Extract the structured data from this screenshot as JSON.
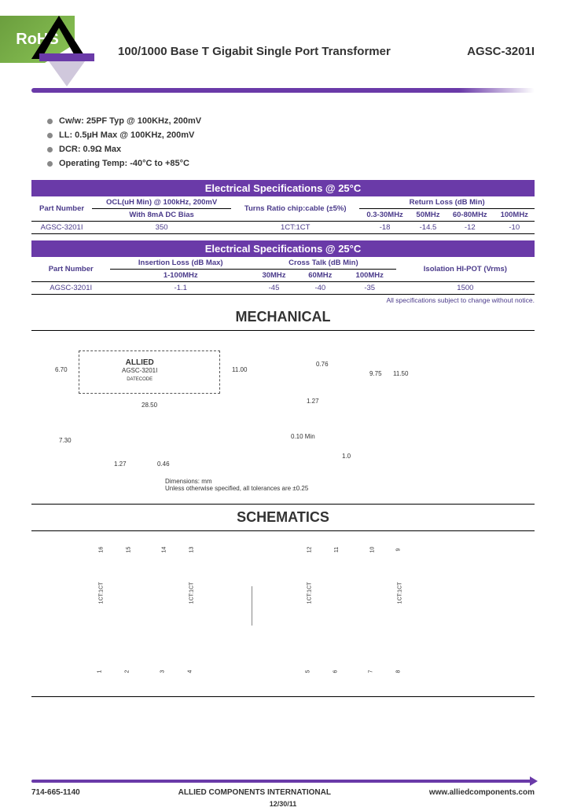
{
  "badge": "RoHS",
  "header": {
    "title": "100/1000 Base T Gigabit Single Port Transformer",
    "part": "AGSC-3201I"
  },
  "bullets": [
    "Cw/w: 25PF Typ @ 100KHz, 200mV",
    "LL: 0.5µH Max @ 100KHz, 200mV",
    "DCR: 0.9Ω Max",
    "Operating Temp: -40°C to +85°C"
  ],
  "tables_header": "Electrical Specifications @ 25°C",
  "table1": {
    "headers": {
      "part": "Part Number",
      "ocl": "OCL(uH Min) @ 100kHz, 200mV",
      "ocl_sub": "With 8mA DC Bias",
      "turns": "Turns Ratio chip:cable (±5%)",
      "rl": "Return Loss (dB Min)",
      "rl_cols": [
        "0.3-30MHz",
        "50MHz",
        "60-80MHz",
        "100MHz"
      ]
    },
    "row": {
      "part": "AGSC-3201I",
      "ocl": "350",
      "turns": "1CT:1CT",
      "rl": [
        "-18",
        "-14.5",
        "-12",
        "-10"
      ]
    }
  },
  "table2": {
    "headers": {
      "part": "Part Number",
      "il": "Insertion Loss (dB Max)",
      "il_sub": "1-100MHz",
      "ct": "Cross Talk (dB Min)",
      "ct_cols": [
        "30MHz",
        "60MHz",
        "100MHz"
      ],
      "iso": "Isolation HI-POT (Vrms)"
    },
    "row": {
      "part": "AGSC-3201I",
      "il": "-1.1",
      "ct": [
        "-45",
        "-40",
        "-35"
      ],
      "iso": "1500"
    },
    "footnote": "All specifications subject to change without notice."
  },
  "mechanical": {
    "title": "MECHANICAL",
    "brand": "ALLIED",
    "part": "AGSC-3201I",
    "dims": {
      "d1": "6.70",
      "d2": "11.00",
      "d3": "0.76",
      "d4": "9.75",
      "d5": "11.50",
      "d6": "28.50",
      "d7": "1.27",
      "d8": "7.30",
      "d9": "1.27",
      "d10": "0.46",
      "d11": "0.10 Min",
      "d12": "1.0"
    },
    "datecode": "DATECODE",
    "note_title": "Dimensions: mm",
    "note": "Unless otherwise specified, all tolerances are ±0.25"
  },
  "schematics": {
    "title": "SCHEMATICS",
    "top_pins": [
      "16",
      "15",
      "14",
      "13",
      "12",
      "11",
      "10",
      "9"
    ],
    "bot_pins": [
      "1",
      "2",
      "3",
      "4",
      "5",
      "6",
      "7",
      "8"
    ],
    "labels": [
      "1CT:1CT",
      "1CT:1CT",
      "1CT:1CT",
      "1CT:1CT"
    ]
  },
  "footer": {
    "phone": "714-665-1140",
    "company": "ALLIED COMPONENTS INTERNATIONAL",
    "url": "www.alliedcomponents.com",
    "date": "12/30/11"
  }
}
